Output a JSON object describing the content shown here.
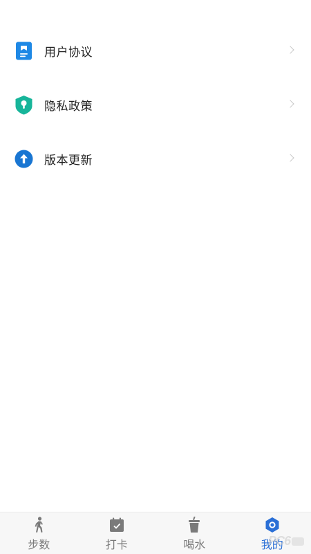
{
  "menu": {
    "items": [
      {
        "label": "用户协议",
        "icon": "document-icon",
        "color": "#1e88e5"
      },
      {
        "label": "隐私政策",
        "icon": "shield-lock-icon",
        "color": "#17b59a"
      },
      {
        "label": "版本更新",
        "icon": "arrow-up-icon",
        "color": "#1976d2"
      }
    ]
  },
  "tabbar": {
    "tabs": [
      {
        "label": "步数",
        "icon": "walking-icon",
        "active": false
      },
      {
        "label": "打卡",
        "icon": "calendar-check-icon",
        "active": false
      },
      {
        "label": "喝水",
        "icon": "cup-icon",
        "active": false
      },
      {
        "label": "我的",
        "icon": "hexagon-user-icon",
        "active": true
      }
    ],
    "active_color": "#2a6fd6",
    "inactive_color": "#7a7a7a"
  },
  "watermark": {
    "text": "PC6"
  }
}
